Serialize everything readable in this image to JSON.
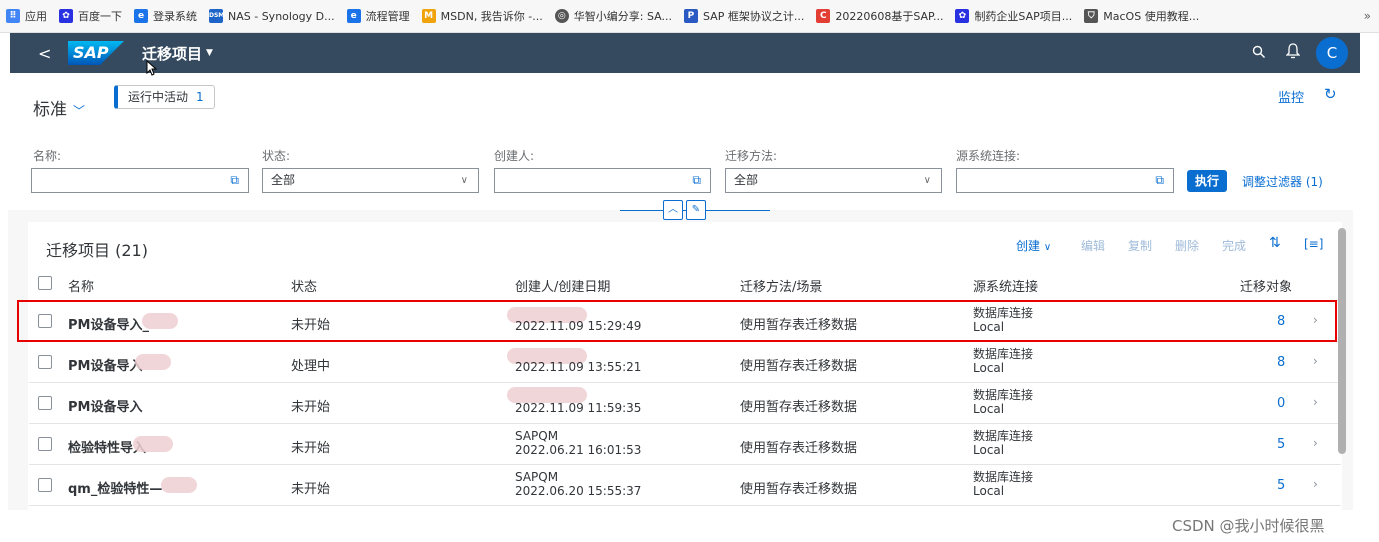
{
  "bookmarks": [
    {
      "label": "应用",
      "icon": "apps-grid-icon",
      "color": "#4285f4"
    },
    {
      "label": "百度一下",
      "icon": "baidu-paw-icon",
      "color": "#2932e1"
    },
    {
      "label": "登录系统",
      "icon": "eke-logo-icon",
      "color": "#1a73e8"
    },
    {
      "label": "NAS - Synology D...",
      "icon": "dsm-icon",
      "color": "#1e64c8"
    },
    {
      "label": "流程管理",
      "icon": "eke-logo-icon",
      "color": "#1a73e8"
    },
    {
      "label": "MSDN, 我告诉你 -...",
      "icon": "msdn-icon",
      "color": "#f0a30a"
    },
    {
      "label": "华智小编分享: SA...",
      "icon": "globe-icon",
      "color": "#555555"
    },
    {
      "label": "SAP 框架协议之计...",
      "icon": "ps-icon",
      "color": "#2b59c3"
    },
    {
      "label": "20220608基于SAP...",
      "icon": "csdn-icon",
      "color": "#e33e33"
    },
    {
      "label": "制药企业SAP项目...",
      "icon": "baidu-paw-icon",
      "color": "#2932e1"
    },
    {
      "label": "MacOS 使用教程...",
      "icon": "shield-icon",
      "color": "#555555"
    }
  ],
  "bookmarks_more": "»",
  "shell": {
    "back": "<",
    "logo": "SAP",
    "title": "迁移项目",
    "avatar": "C"
  },
  "header": {
    "variant": "标准",
    "active_token_label": "运行中活动",
    "active_token_count": "1",
    "monitor": "监控"
  },
  "filters": {
    "name_label": "名称:",
    "status_label": "状态:",
    "status_value": "全部",
    "creator_label": "创建人:",
    "method_label": "迁移方法:",
    "method_value": "全部",
    "conn_label": "源系统连接:",
    "go": "执行",
    "adapt": "调整过滤器 (1)"
  },
  "table": {
    "title": "迁移项目 (21)",
    "toolbar": {
      "create": "创建",
      "edit": "编辑",
      "copy": "复制",
      "delete": "删除",
      "complete": "完成"
    },
    "columns": {
      "name": "名称",
      "status": "状态",
      "creator": "创建人/创建日期",
      "method": "迁移方法/场景",
      "conn": "源系统连接",
      "count": "迁移对象"
    },
    "rows": [
      {
        "name": "PM设备导入_",
        "status": "未开始",
        "creator": "",
        "date": "2022.11.09 15:29:49",
        "method": "使用暂存表迁移数据",
        "conn1": "数据库连接",
        "conn2": "Local",
        "count": "8"
      },
      {
        "name": "PM设备导入",
        "status": "处理中",
        "creator": "",
        "date": "2022.11.09 13:55:21",
        "method": "使用暂存表迁移数据",
        "conn1": "数据库连接",
        "conn2": "Local",
        "count": "8"
      },
      {
        "name": "PM设备导入",
        "status": "未开始",
        "creator": "",
        "date": "2022.11.09 11:59:35",
        "method": "使用暂存表迁移数据",
        "conn1": "数据库连接",
        "conn2": "Local",
        "count": "0"
      },
      {
        "name": "检验特性导入",
        "status": "未开始",
        "creator": "SAPQM",
        "date": "2022.06.21 16:01:53",
        "method": "使用暂存表迁移数据",
        "conn1": "数据库连接",
        "conn2": "Local",
        "count": "5"
      },
      {
        "name": "qm_检验特性—",
        "status": "未开始",
        "creator": "SAPQM",
        "date": "2022.06.20 15:55:37",
        "method": "使用暂存表迁移数据",
        "conn1": "数据库连接",
        "conn2": "Local",
        "count": "5"
      }
    ]
  },
  "watermark": "CSDN @我小时候很黑"
}
